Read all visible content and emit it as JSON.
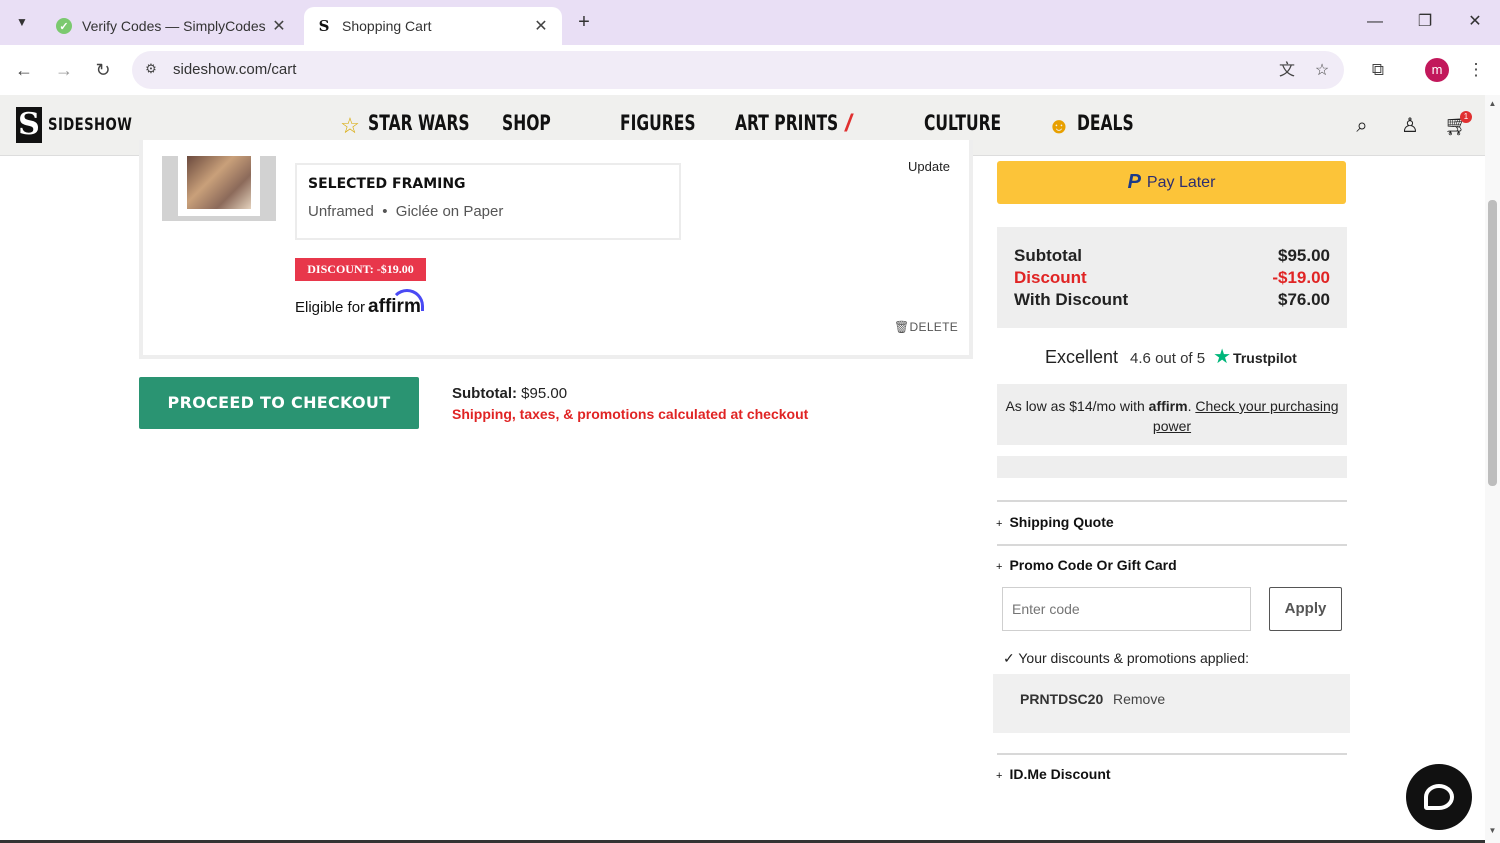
{
  "browser": {
    "tabs": [
      {
        "title": "Verify Codes — SimplyCodes",
        "active": false,
        "icon": "simplycodes-icon"
      },
      {
        "title": "Shopping Cart",
        "active": true,
        "icon": "sideshow-icon"
      }
    ],
    "url": "sideshow.com/cart",
    "profile_initial": "m"
  },
  "site": {
    "logo_mark": "S",
    "logo_text": "SIDESHOW",
    "nav": {
      "star_wars": "STAR WARS",
      "shop": "SHOP",
      "figures": "FIGURES",
      "art_prints": "ART PRINTS",
      "slash": "/",
      "culture": "CULTURE",
      "deals": "DEALS"
    },
    "cart_count": "1"
  },
  "cart_item": {
    "update_label": "Update",
    "framing_title": "SELECTED FRAMING",
    "framing_desc": "Unframed  •  Giclée on Paper",
    "discount_badge": "DISCOUNT: -$19.00",
    "eligible_text": "Eligible for",
    "affirm_brand": "affirm",
    "delete_label": "DELETE"
  },
  "checkout": {
    "button_label": "PROCEED TO CHECKOUT",
    "subtotal_label": "Subtotal:",
    "subtotal_value": "$95.00",
    "shipping_note": "Shipping, taxes, & promotions calculated at checkout"
  },
  "summary": {
    "paypal_mark": "P",
    "paylater_label": "Pay Later",
    "rows": [
      {
        "label": "Subtotal",
        "value": "$95.00"
      },
      {
        "label": "Discount",
        "value": "-$19.00"
      },
      {
        "label": "With Discount",
        "value": "$76.00"
      }
    ],
    "trustpilot": {
      "rating_word": "Excellent",
      "score_text": "4.6 out of 5",
      "brand": "Trustpilot"
    },
    "affirm": {
      "prefix": "As low as $14/mo with",
      "brand": "affirm",
      "link_text": "Check your purchasing power"
    },
    "sections": {
      "shipping_quote": "Shipping Quote",
      "promo_code": "Promo Code Or Gift Card",
      "idme": "ID.Me Discount"
    },
    "promo_input_placeholder": "Enter code",
    "apply_label": "Apply",
    "applied_note": "Your discounts & promotions applied:",
    "applied_code": "PRNTDSC20",
    "remove_label": "Remove"
  },
  "colors": {
    "checkout_green": "#2a9472",
    "discount_red": "#e02424",
    "paylater_yellow": "#fcc439",
    "trustpilot_green": "#00b67a"
  }
}
